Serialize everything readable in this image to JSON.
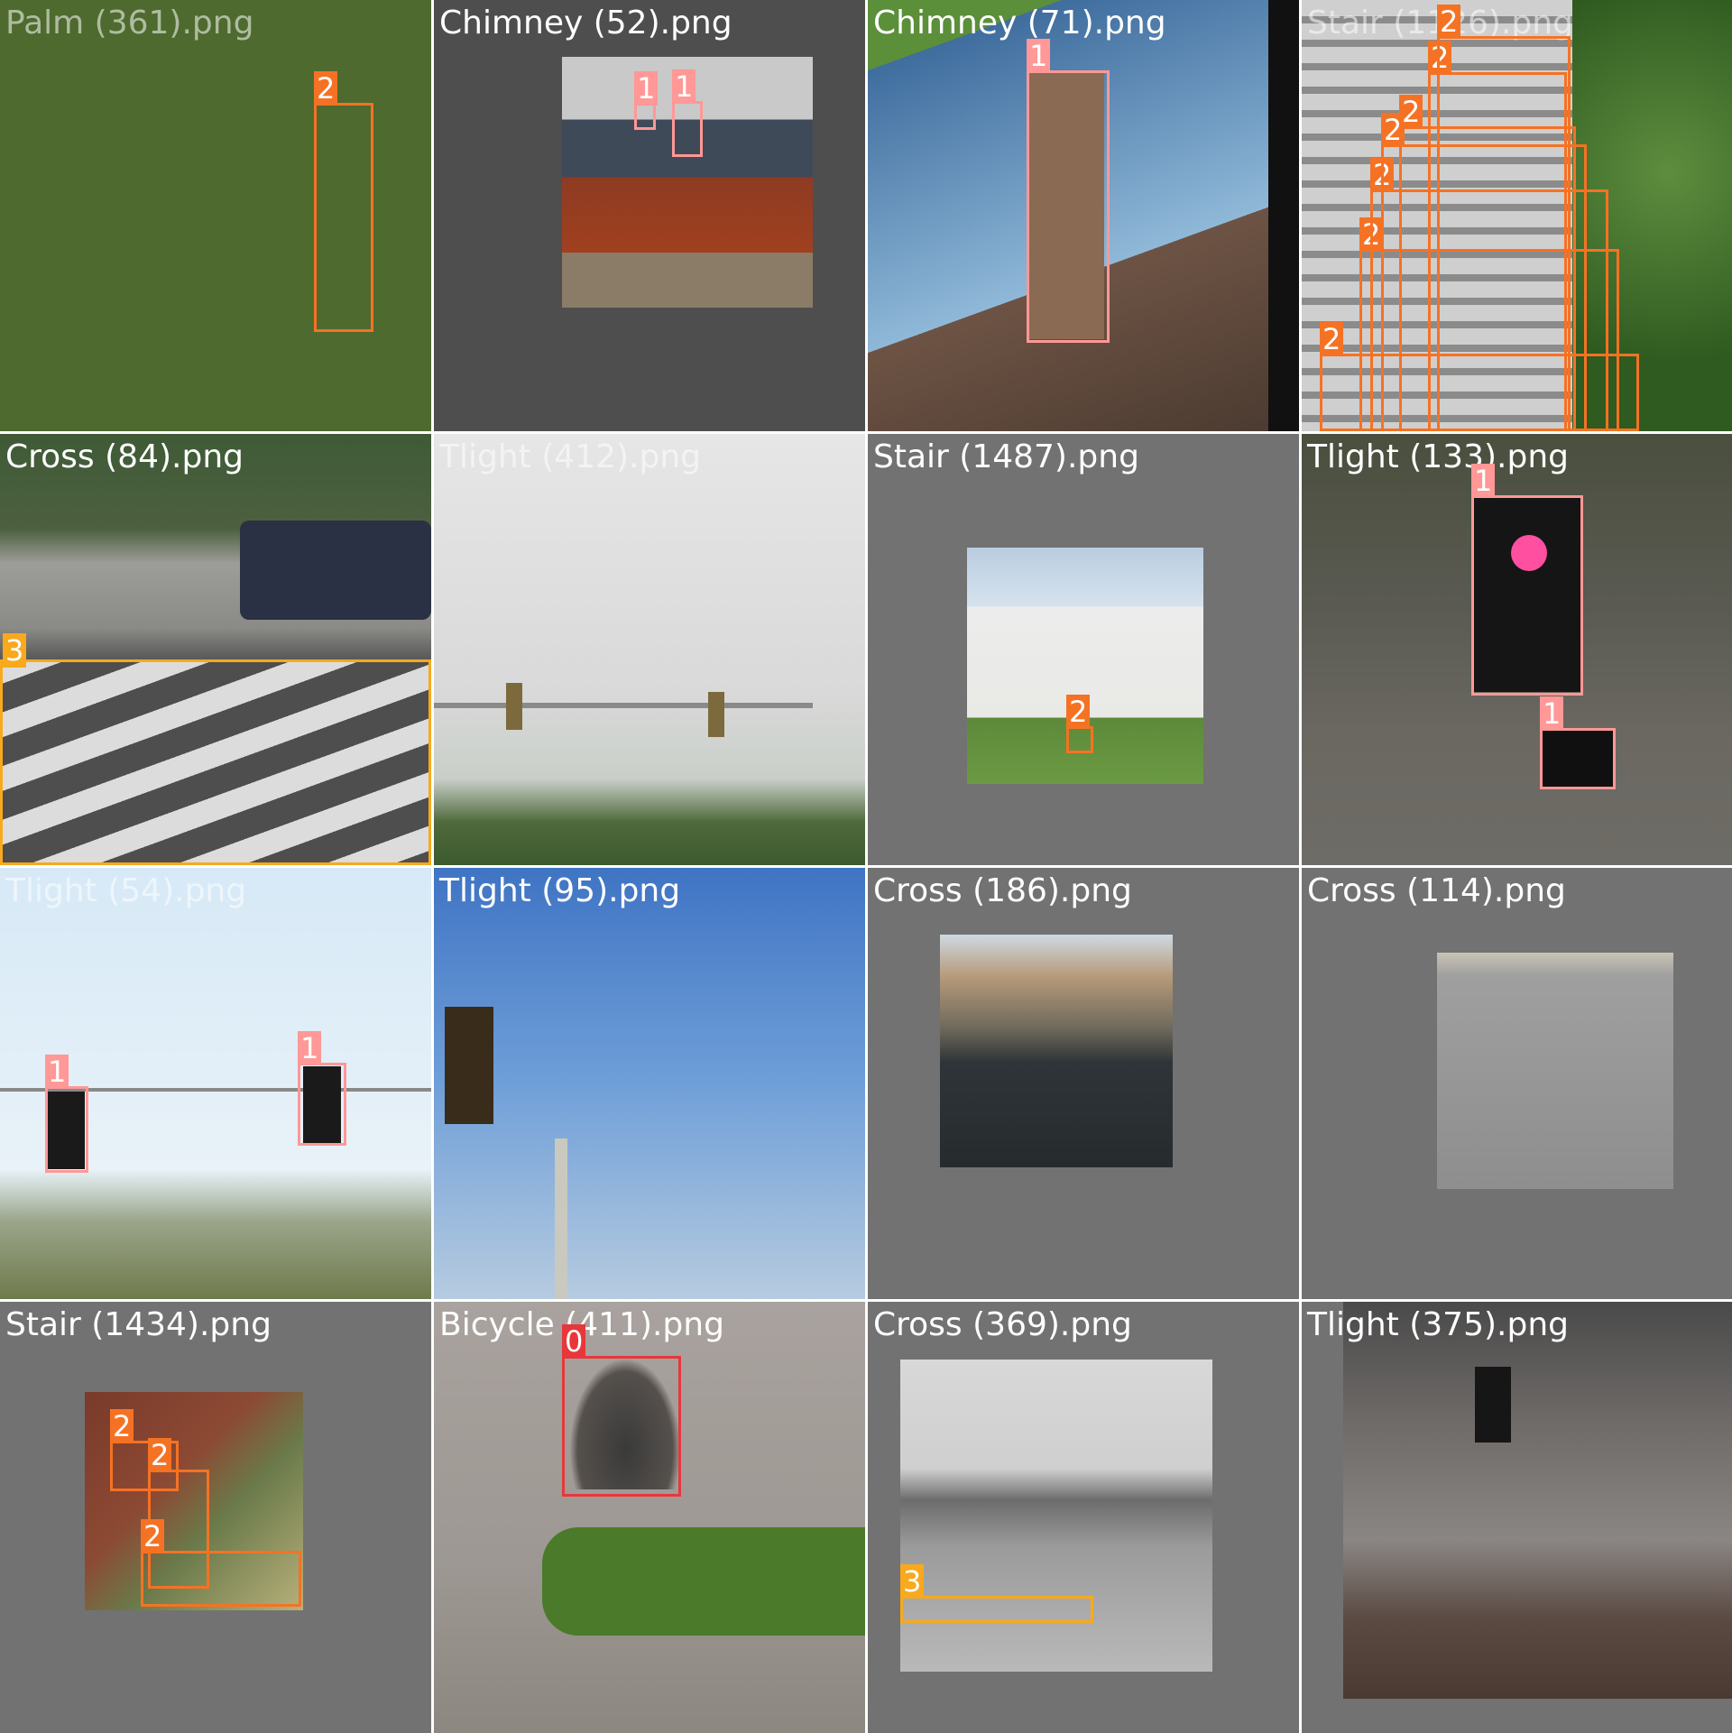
{
  "colors": {
    "class_0": "#e8373b",
    "class_1": "#ff9896",
    "class_2": "#f57224",
    "class_3": "#f8a91d"
  },
  "tiles": [
    {
      "filename": "Palm (361).png",
      "boxes": [
        {
          "label": "2"
        }
      ]
    },
    {
      "filename": "Chimney (52).png",
      "boxes": [
        {
          "label": "1"
        },
        {
          "label": "1"
        }
      ]
    },
    {
      "filename": "Chimney (71).png",
      "boxes": [
        {
          "label": "1"
        }
      ]
    },
    {
      "filename": "Stair (1126).png",
      "boxes": [
        {
          "label": "2"
        },
        {
          "label": "2"
        },
        {
          "label": "2"
        },
        {
          "label": "2"
        },
        {
          "label": "2"
        },
        {
          "label": "2"
        },
        {
          "label": "2"
        }
      ]
    },
    {
      "filename": "Cross (84).png",
      "boxes": [
        {
          "label": "3"
        }
      ]
    },
    {
      "filename": "Tlight (412).png",
      "boxes": []
    },
    {
      "filename": "Stair (1487).png",
      "boxes": [
        {
          "label": "2"
        }
      ]
    },
    {
      "filename": "Tlight (133).png",
      "boxes": [
        {
          "label": "1"
        },
        {
          "label": "1"
        }
      ]
    },
    {
      "filename": "Tlight (54).png",
      "boxes": [
        {
          "label": "1"
        },
        {
          "label": "1"
        }
      ]
    },
    {
      "filename": "Tlight (95).png",
      "boxes": []
    },
    {
      "filename": "Cross (186).png",
      "boxes": []
    },
    {
      "filename": "Cross (114).png",
      "boxes": []
    },
    {
      "filename": "Stair (1434).png",
      "boxes": [
        {
          "label": "2"
        },
        {
          "label": "2"
        },
        {
          "label": "2"
        }
      ]
    },
    {
      "filename": "Bicycle (411).png",
      "boxes": [
        {
          "label": "0"
        }
      ]
    },
    {
      "filename": "Cross (369).png",
      "boxes": [
        {
          "label": "3"
        }
      ]
    },
    {
      "filename": "Tlight (375).png",
      "boxes": []
    }
  ]
}
